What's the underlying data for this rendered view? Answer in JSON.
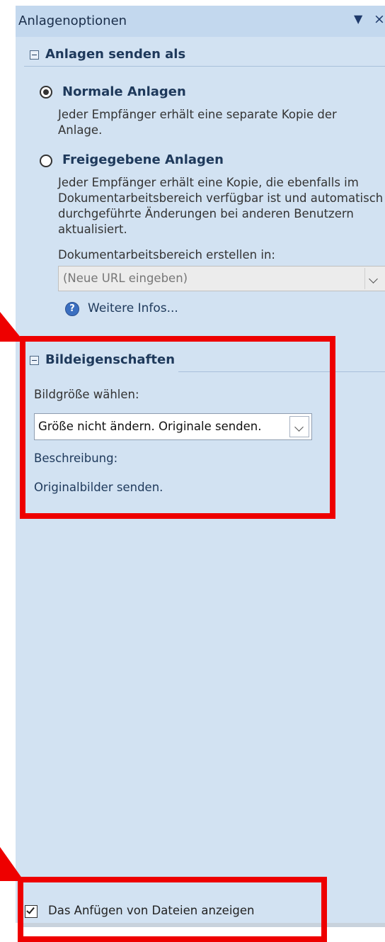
{
  "pane": {
    "title": "Anlagenoptionen",
    "dropdown_glyph": "▼",
    "close_glyph": "×"
  },
  "send_as": {
    "heading": "Anlagen senden als",
    "normal_label": "Normale Anlagen",
    "normal_selected": true,
    "normal_desc": "Jeder Empfänger erhält eine separate Kopie der Anlage.",
    "shared_label": "Freigegebene Anlagen",
    "shared_selected": false,
    "shared_desc": "Jeder Empfänger erhält eine Kopie, die ebenfalls im Dokumentarbeitsbereich verfügbar ist und automatisch durchgeführte Änderungen bei anderen Benutzern aktualisiert.",
    "workspace_label": "Dokumentarbeitsbereich erstellen in:",
    "workspace_value": "(Neue URL eingeben)",
    "more_info": "Weitere Infos..."
  },
  "image_props": {
    "heading": "Bildeigenschaften",
    "size_label": "Bildgröße wählen:",
    "size_value": "Größe nicht ändern. Originale senden.",
    "desc_label": "Beschreibung:",
    "desc_value": "Originalbilder senden."
  },
  "footer": {
    "show_attach_label": "Das Anfügen von Dateien anzeigen",
    "show_attach_checked": true
  },
  "colors": {
    "highlight": "#ee0000",
    "pane_bg": "#d2e2f2",
    "heading_text": "#1e395b"
  }
}
